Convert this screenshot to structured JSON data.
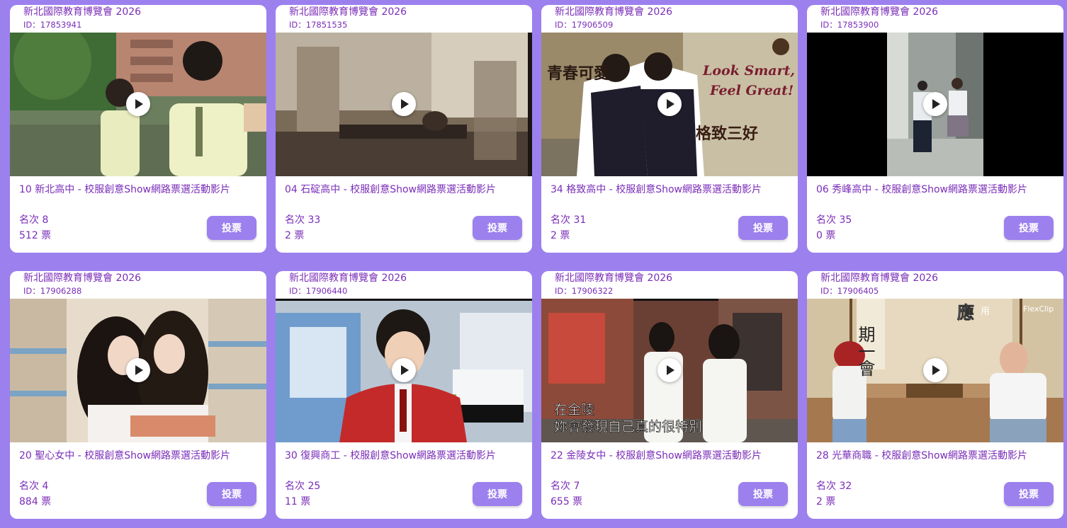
{
  "cards": [
    {
      "event": "新北國際教育博覽會 2026",
      "id_text": "ID：17853941",
      "title": "10 新北高中 - 校服創意Show網路票選活動影片",
      "rank": "名次 8",
      "votes": "512 票",
      "button": "投票"
    },
    {
      "event": "新北國際教育博覽會 2026",
      "id_text": "ID：17851535",
      "title": "04 石碇高中 - 校服創意Show網路票選活動影片",
      "rank": "名次 33",
      "votes": "2 票",
      "button": "投票"
    },
    {
      "event": "新北國際教育博覽會 2026",
      "id_text": "ID：17906509",
      "title": "34 格致高中 - 校服創意Show網路票選活動影片",
      "rank": "名次 31",
      "votes": "2 票",
      "button": "投票"
    },
    {
      "event": "新北國際教育博覽會 2026",
      "id_text": "ID：17853900",
      "title": "06 秀峰高中 - 校服創意Show網路票選活動影片",
      "rank": "名次 35",
      "votes": "0 票",
      "button": "投票"
    },
    {
      "event": "新北國際教育博覽會 2026",
      "id_text": "ID：17906288",
      "title": "20 聖心女中 - 校服創意Show網路票選活動影片",
      "rank": "名次 4",
      "votes": "884 票",
      "button": "投票"
    },
    {
      "event": "新北國際教育博覽會 2026",
      "id_text": "ID：17906440",
      "title": "30 復興商工 - 校服創意Show網路票選活動影片",
      "rank": "名次 25",
      "votes": "11 票",
      "button": "投票"
    },
    {
      "event": "新北國際教育博覽會 2026",
      "id_text": "ID：17906322",
      "title": "22 金陵女中 - 校服創意Show網路票選活動影片",
      "rank": "名次 7",
      "votes": "655 票",
      "button": "投票"
    },
    {
      "event": "新北國際教育博覽會 2026",
      "id_text": "ID：17906405",
      "title": "28 光華商職 - 校服創意Show網路票選活動影片",
      "rank": "名次 32",
      "votes": "2 票",
      "button": "投票"
    }
  ],
  "overlays": {
    "c2_left": "青春可愛",
    "c2_right1": "Look Smart,",
    "c2_right2": "Feel Great!",
    "c2_bottom": "格致三好",
    "c6_line1": "在金陵",
    "c6_line2": "妳會發現自己真的很特別",
    "c7_top": "應",
    "c7_small": "用",
    "c7_scroll": "期一會",
    "c7_logo": "FlexClip"
  },
  "colors": {
    "background": "#9C80EE",
    "card": "#ffffff",
    "text_purple": "#7A2DB8",
    "button": "#9C80EE"
  }
}
